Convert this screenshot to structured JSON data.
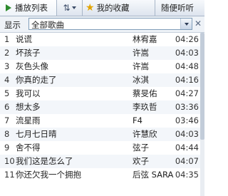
{
  "tabs": {
    "playlist_label": "播放列表",
    "favorites_label": "我的收藏",
    "random_label": "随便听听"
  },
  "filter": {
    "label": "显示",
    "selected": "全部歌曲"
  },
  "songs": [
    {
      "num": "1",
      "title": "说谎",
      "artist": "林宥嘉",
      "duration": "04:26"
    },
    {
      "num": "2",
      "title": "坏孩子",
      "artist": "许嵩",
      "duration": "04:03"
    },
    {
      "num": "3",
      "title": "灰色头像",
      "artist": "许嵩",
      "duration": "04:48"
    },
    {
      "num": "4",
      "title": "你真的走了",
      "artist": "冰淇",
      "duration": "04:16"
    },
    {
      "num": "5",
      "title": "我可以",
      "artist": "蔡旻佑",
      "duration": "04:27"
    },
    {
      "num": "6",
      "title": "想太多",
      "artist": "李玖哲",
      "duration": "03:36"
    },
    {
      "num": "7",
      "title": "流星雨",
      "artist": "F4",
      "duration": "03:46"
    },
    {
      "num": "8",
      "title": "七月七日晴",
      "artist": "许慧欣",
      "duration": "04:03"
    },
    {
      "num": "9",
      "title": "舍不得",
      "artist": "弦子",
      "duration": "04:44"
    },
    {
      "num": "10",
      "title": "我们这是怎么了",
      "artist": "欢子",
      "duration": "04:07"
    },
    {
      "num": "11",
      "title": "你还欠我一个拥抱",
      "artist": "后弦 SARA",
      "duration": "04:35"
    }
  ],
  "scroll_position": 0
}
